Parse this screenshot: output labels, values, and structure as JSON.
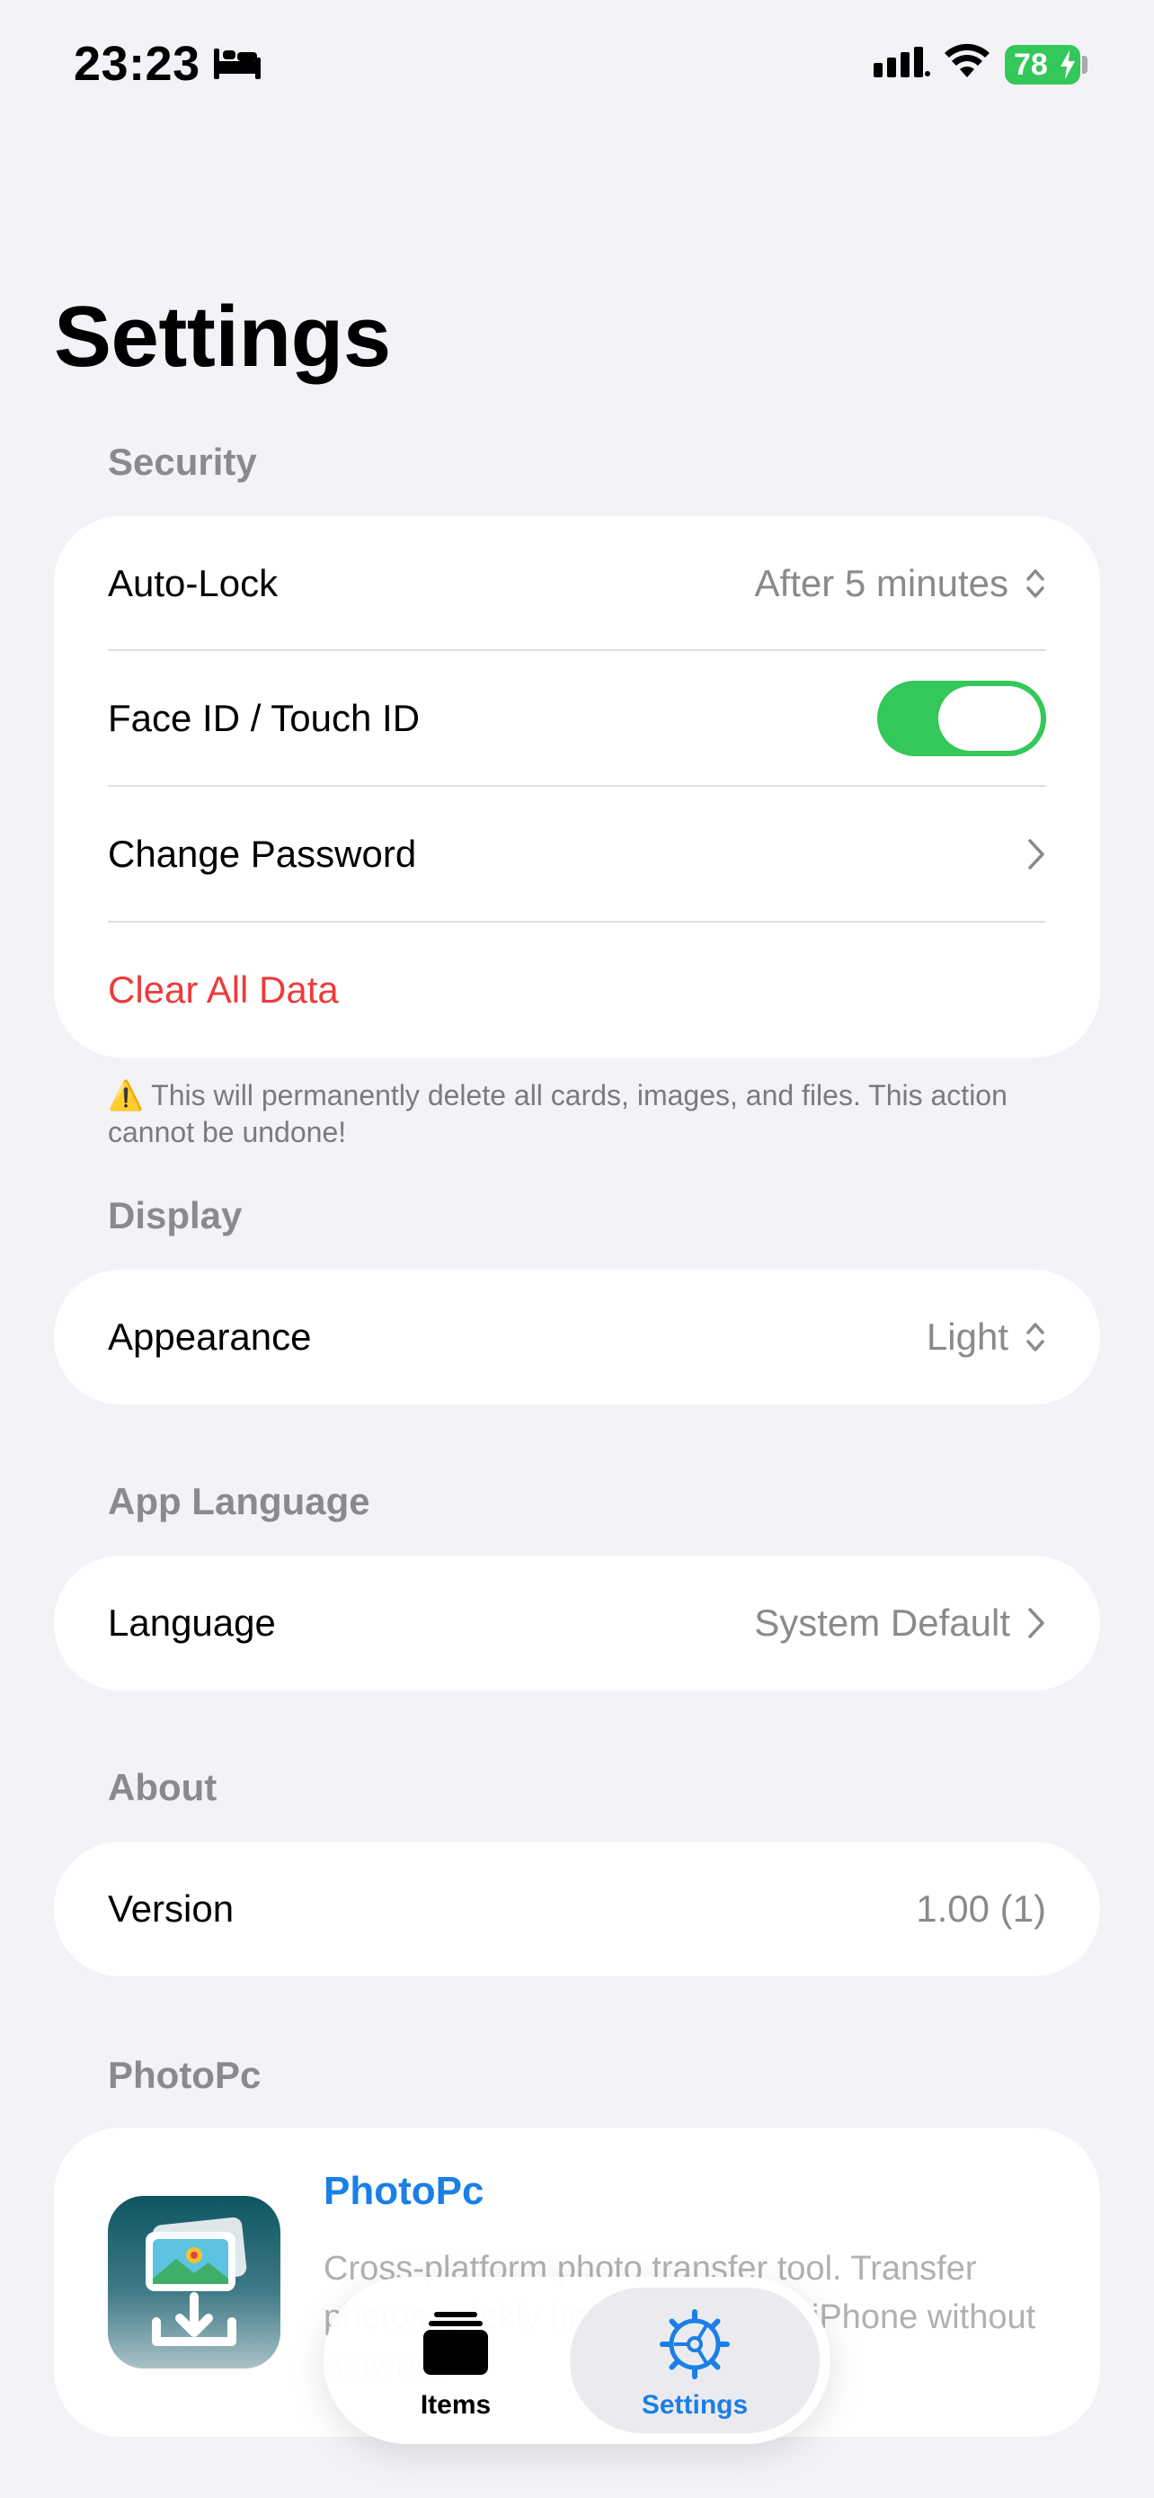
{
  "status_bar": {
    "time": "23:23",
    "battery": "78",
    "focus_icon": "bed-icon",
    "signal_icon": "cellular-signal-icon",
    "wifi_icon": "wifi-icon"
  },
  "page_title": "Settings",
  "security": {
    "header": "Security",
    "auto_lock_label": "Auto-Lock",
    "auto_lock_value": "After 5 minutes",
    "face_id_label": "Face ID / Touch ID",
    "face_id_enabled": true,
    "change_password_label": "Change Password",
    "clear_all_label": "Clear All Data",
    "warning": "⚠️ This will permanently delete all cards, images, and files. This action cannot be undone!"
  },
  "display": {
    "header": "Display",
    "appearance_label": "Appearance",
    "appearance_value": "Light"
  },
  "app_language": {
    "header": "App Language",
    "language_label": "Language",
    "language_value": "System Default"
  },
  "about": {
    "header": "About",
    "version_label": "Version",
    "version_value": "1.00 (1)"
  },
  "photopc": {
    "header": "PhotoPc",
    "app_name": "PhotoPc",
    "description": "Cross-platform photo transfer tool. Transfer photos quickly between PC and iPhone without network"
  },
  "tabbar": {
    "items_label": "Items",
    "settings_label": "Settings",
    "active_tab": "Settings",
    "accent": "#1a7fe6"
  },
  "colors": {
    "toggle_on": "#34c759",
    "danger": "#ee3b3b",
    "background": "#f2f2f7"
  }
}
